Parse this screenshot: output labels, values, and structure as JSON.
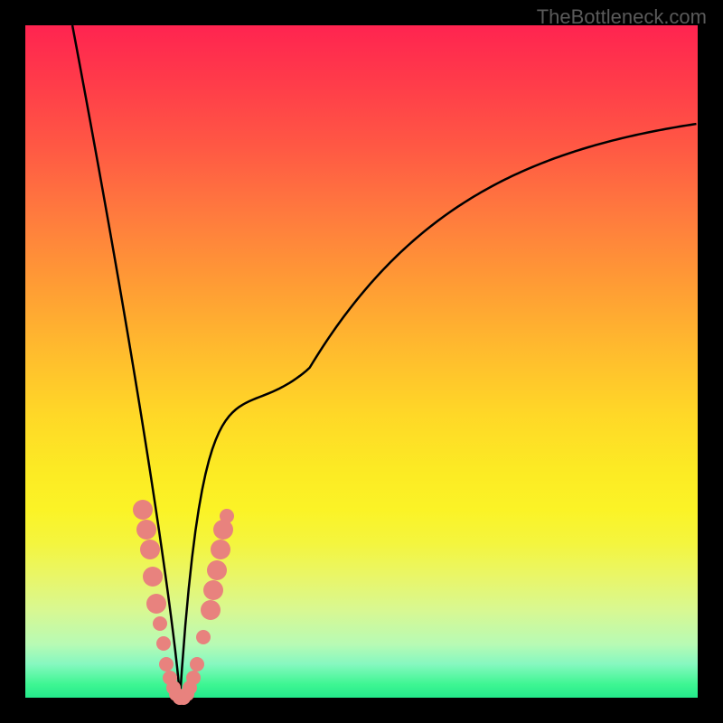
{
  "watermark": "TheBottleneck.com",
  "chart_data": {
    "type": "line",
    "title": "",
    "xlabel": "",
    "ylabel": "",
    "xlim": [
      0,
      100
    ],
    "ylim": [
      0,
      100
    ],
    "background": "gradient-heat",
    "curve_description": "V-shaped bottleneck curve with minimum near x=23",
    "minimum_x": 23,
    "series": [
      {
        "name": "bottleneck-curve",
        "type": "line",
        "color": "#000000",
        "points": [
          {
            "x": 7,
            "y": 100
          },
          {
            "x": 10,
            "y": 85
          },
          {
            "x": 13,
            "y": 68
          },
          {
            "x": 16,
            "y": 50
          },
          {
            "x": 19,
            "y": 30
          },
          {
            "x": 21,
            "y": 12
          },
          {
            "x": 23,
            "y": 0
          },
          {
            "x": 25,
            "y": 8
          },
          {
            "x": 28,
            "y": 20
          },
          {
            "x": 32,
            "y": 32
          },
          {
            "x": 40,
            "y": 48
          },
          {
            "x": 50,
            "y": 60
          },
          {
            "x": 60,
            "y": 69
          },
          {
            "x": 70,
            "y": 76
          },
          {
            "x": 80,
            "y": 82
          },
          {
            "x": 90,
            "y": 86
          },
          {
            "x": 100,
            "y": 89
          }
        ]
      },
      {
        "name": "data-markers",
        "type": "scatter",
        "color": "#e8827e",
        "points": [
          {
            "x": 17.5,
            "y": 28
          },
          {
            "x": 18.0,
            "y": 25
          },
          {
            "x": 18.5,
            "y": 22
          },
          {
            "x": 19.0,
            "y": 18
          },
          {
            "x": 19.5,
            "y": 14
          },
          {
            "x": 20.0,
            "y": 11
          },
          {
            "x": 20.5,
            "y": 8
          },
          {
            "x": 21.0,
            "y": 5
          },
          {
            "x": 21.5,
            "y": 3
          },
          {
            "x": 22.0,
            "y": 1.5
          },
          {
            "x": 22.5,
            "y": 0.5
          },
          {
            "x": 23.0,
            "y": 0
          },
          {
            "x": 23.5,
            "y": 0
          },
          {
            "x": 24.0,
            "y": 0.5
          },
          {
            "x": 24.5,
            "y": 1.5
          },
          {
            "x": 25.0,
            "y": 3
          },
          {
            "x": 25.5,
            "y": 5
          },
          {
            "x": 26.5,
            "y": 9
          },
          {
            "x": 27.5,
            "y": 13
          },
          {
            "x": 28.0,
            "y": 16
          },
          {
            "x": 28.5,
            "y": 19
          },
          {
            "x": 29.0,
            "y": 22
          },
          {
            "x": 29.5,
            "y": 25
          },
          {
            "x": 30.0,
            "y": 27
          }
        ]
      }
    ]
  }
}
